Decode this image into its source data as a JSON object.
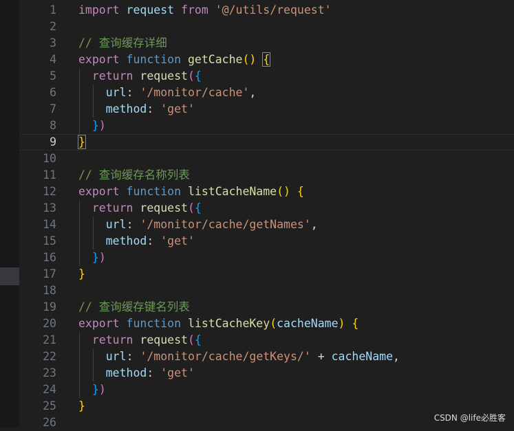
{
  "editor": {
    "current_line": 9,
    "lines": [
      {
        "n": "1",
        "tokens": [
          {
            "t": "import",
            "c": "k"
          },
          {
            "t": " ",
            "c": "p"
          },
          {
            "t": "request",
            "c": "v"
          },
          {
            "t": " ",
            "c": "p"
          },
          {
            "t": "from",
            "c": "k"
          },
          {
            "t": " ",
            "c": "p"
          },
          {
            "t": "'@/utils/request'",
            "c": "s"
          }
        ]
      },
      {
        "n": "2",
        "tokens": []
      },
      {
        "n": "3",
        "tokens": [
          {
            "t": "// 查询缓存详细",
            "c": "c"
          }
        ]
      },
      {
        "n": "4",
        "tokens": [
          {
            "t": "export",
            "c": "k"
          },
          {
            "t": " ",
            "c": "p"
          },
          {
            "t": "function",
            "c": "kb"
          },
          {
            "t": " ",
            "c": "p"
          },
          {
            "t": "getCache",
            "c": "f"
          },
          {
            "t": "()",
            "c": "b1"
          },
          {
            "t": " ",
            "c": "p"
          },
          {
            "t": "{",
            "c": "b1 bm"
          }
        ]
      },
      {
        "n": "5",
        "tokens": [
          {
            "t": "  ",
            "c": "p"
          },
          {
            "t": "return",
            "c": "k"
          },
          {
            "t": " ",
            "c": "p"
          },
          {
            "t": "request",
            "c": "f"
          },
          {
            "t": "(",
            "c": "b2"
          },
          {
            "t": "{",
            "c": "b3"
          }
        ]
      },
      {
        "n": "6",
        "tokens": [
          {
            "t": "    ",
            "c": "p"
          },
          {
            "t": "url",
            "c": "v"
          },
          {
            "t": ": ",
            "c": "p"
          },
          {
            "t": "'/monitor/cache'",
            "c": "s"
          },
          {
            "t": ",",
            "c": "p"
          }
        ]
      },
      {
        "n": "7",
        "tokens": [
          {
            "t": "    ",
            "c": "p"
          },
          {
            "t": "method",
            "c": "v"
          },
          {
            "t": ": ",
            "c": "p"
          },
          {
            "t": "'get'",
            "c": "s"
          }
        ]
      },
      {
        "n": "8",
        "tokens": [
          {
            "t": "  ",
            "c": "p"
          },
          {
            "t": "}",
            "c": "b3"
          },
          {
            "t": ")",
            "c": "b2"
          }
        ]
      },
      {
        "n": "9",
        "tokens": [
          {
            "t": "}",
            "c": "b1 bm"
          }
        ]
      },
      {
        "n": "10",
        "tokens": []
      },
      {
        "n": "11",
        "tokens": [
          {
            "t": "// 查询缓存名称列表",
            "c": "c"
          }
        ]
      },
      {
        "n": "12",
        "tokens": [
          {
            "t": "export",
            "c": "k"
          },
          {
            "t": " ",
            "c": "p"
          },
          {
            "t": "function",
            "c": "kb"
          },
          {
            "t": " ",
            "c": "p"
          },
          {
            "t": "listCacheName",
            "c": "f"
          },
          {
            "t": "()",
            "c": "b1"
          },
          {
            "t": " ",
            "c": "p"
          },
          {
            "t": "{",
            "c": "b1"
          }
        ]
      },
      {
        "n": "13",
        "tokens": [
          {
            "t": "  ",
            "c": "p"
          },
          {
            "t": "return",
            "c": "k"
          },
          {
            "t": " ",
            "c": "p"
          },
          {
            "t": "request",
            "c": "f"
          },
          {
            "t": "(",
            "c": "b2"
          },
          {
            "t": "{",
            "c": "b3"
          }
        ]
      },
      {
        "n": "14",
        "tokens": [
          {
            "t": "    ",
            "c": "p"
          },
          {
            "t": "url",
            "c": "v"
          },
          {
            "t": ": ",
            "c": "p"
          },
          {
            "t": "'/monitor/cache/getNames'",
            "c": "s"
          },
          {
            "t": ",",
            "c": "p"
          }
        ]
      },
      {
        "n": "15",
        "tokens": [
          {
            "t": "    ",
            "c": "p"
          },
          {
            "t": "method",
            "c": "v"
          },
          {
            "t": ": ",
            "c": "p"
          },
          {
            "t": "'get'",
            "c": "s"
          }
        ]
      },
      {
        "n": "16",
        "tokens": [
          {
            "t": "  ",
            "c": "p"
          },
          {
            "t": "}",
            "c": "b3"
          },
          {
            "t": ")",
            "c": "b2"
          }
        ]
      },
      {
        "n": "17",
        "tokens": [
          {
            "t": "}",
            "c": "b1"
          }
        ]
      },
      {
        "n": "18",
        "tokens": []
      },
      {
        "n": "19",
        "tokens": [
          {
            "t": "// 查询缓存键名列表",
            "c": "c"
          }
        ]
      },
      {
        "n": "20",
        "tokens": [
          {
            "t": "export",
            "c": "k"
          },
          {
            "t": " ",
            "c": "p"
          },
          {
            "t": "function",
            "c": "kb"
          },
          {
            "t": " ",
            "c": "p"
          },
          {
            "t": "listCacheKey",
            "c": "f"
          },
          {
            "t": "(",
            "c": "b1"
          },
          {
            "t": "cacheName",
            "c": "v"
          },
          {
            "t": ")",
            "c": "b1"
          },
          {
            "t": " ",
            "c": "p"
          },
          {
            "t": "{",
            "c": "b1"
          }
        ]
      },
      {
        "n": "21",
        "tokens": [
          {
            "t": "  ",
            "c": "p"
          },
          {
            "t": "return",
            "c": "k"
          },
          {
            "t": " ",
            "c": "p"
          },
          {
            "t": "request",
            "c": "f"
          },
          {
            "t": "(",
            "c": "b2"
          },
          {
            "t": "{",
            "c": "b3"
          }
        ]
      },
      {
        "n": "22",
        "tokens": [
          {
            "t": "    ",
            "c": "p"
          },
          {
            "t": "url",
            "c": "v"
          },
          {
            "t": ": ",
            "c": "p"
          },
          {
            "t": "'/monitor/cache/getKeys/'",
            "c": "s"
          },
          {
            "t": " + ",
            "c": "p"
          },
          {
            "t": "cacheName",
            "c": "v"
          },
          {
            "t": ",",
            "c": "p"
          }
        ]
      },
      {
        "n": "23",
        "tokens": [
          {
            "t": "    ",
            "c": "p"
          },
          {
            "t": "method",
            "c": "v"
          },
          {
            "t": ": ",
            "c": "p"
          },
          {
            "t": "'get'",
            "c": "s"
          }
        ]
      },
      {
        "n": "24",
        "tokens": [
          {
            "t": "  ",
            "c": "p"
          },
          {
            "t": "}",
            "c": "b3"
          },
          {
            "t": ")",
            "c": "b2"
          }
        ]
      },
      {
        "n": "25",
        "tokens": [
          {
            "t": "}",
            "c": "b1"
          }
        ]
      },
      {
        "n": "26",
        "tokens": []
      }
    ]
  },
  "watermark": "CSDN @life必胜客"
}
